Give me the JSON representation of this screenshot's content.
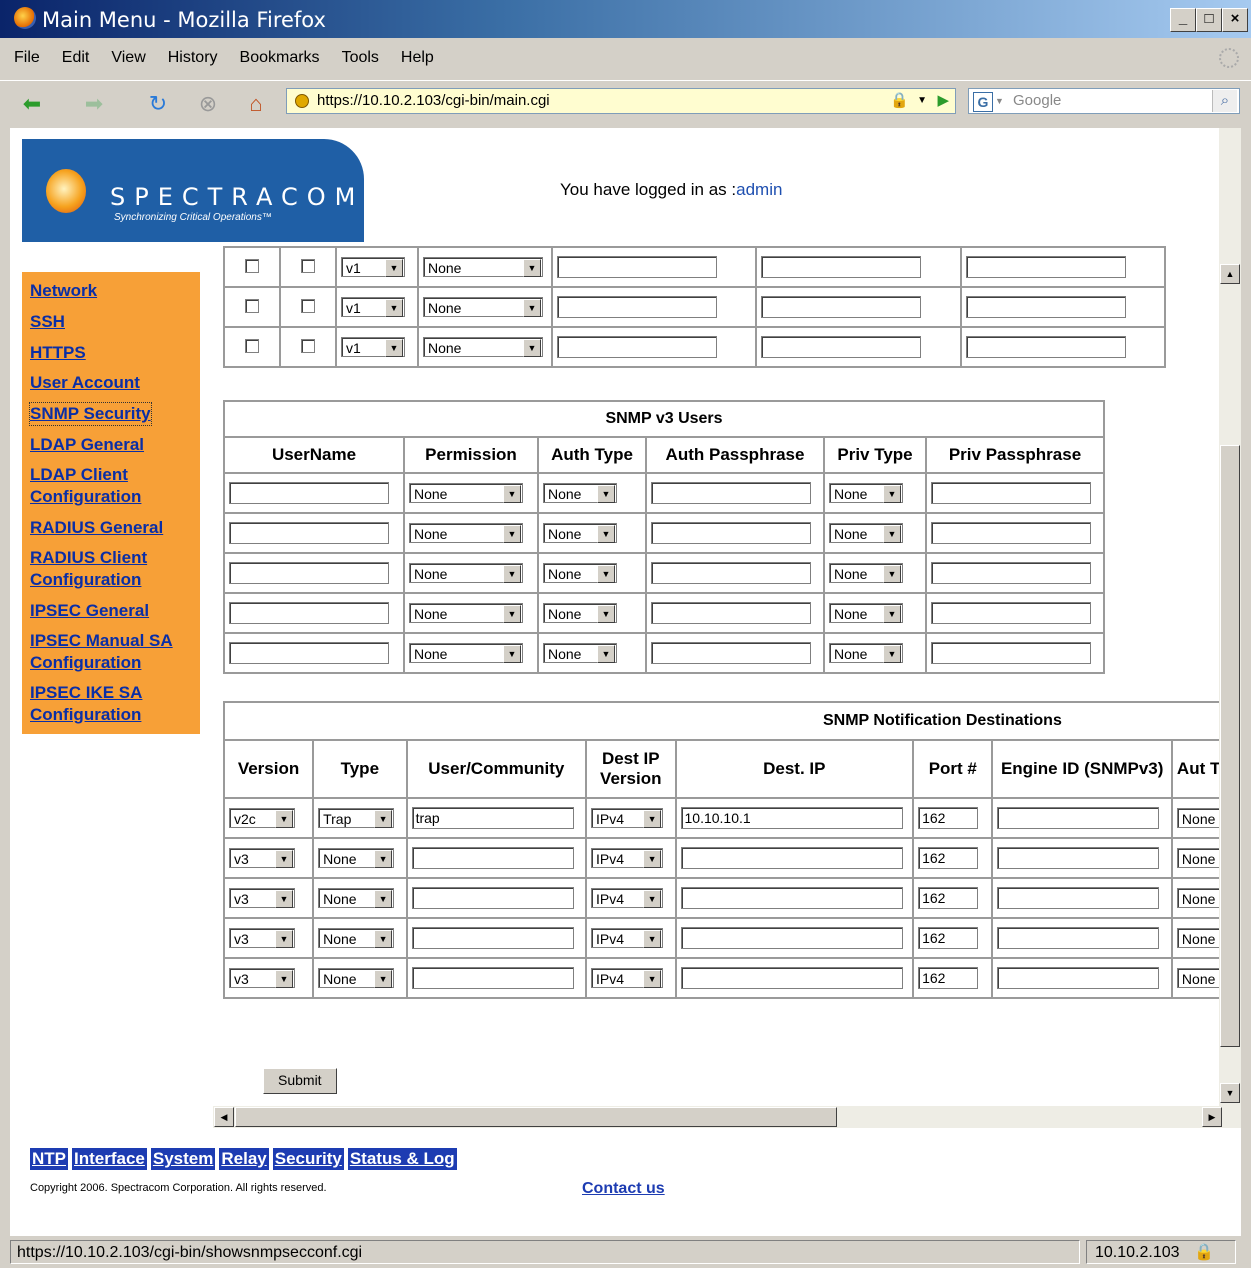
{
  "window": {
    "title": "Main Menu - Mozilla Firefox",
    "min": "_",
    "max": "□",
    "close": "×"
  },
  "menubar": [
    "File",
    "Edit",
    "View",
    "History",
    "Bookmarks",
    "Tools",
    "Help"
  ],
  "navbar": {
    "url": "https://10.10.2.103/cgi-bin/main.cgi",
    "search_placeholder": "Google"
  },
  "logo": {
    "brand": "SPECTRACOM",
    "tagline": "Synchronizing Critical Operations™"
  },
  "login": {
    "prefix": "You have logged in as :",
    "user": "admin"
  },
  "sidebar": [
    "Network",
    "SSH",
    "HTTPS",
    "User Account",
    "SNMP Security",
    "LDAP General",
    "LDAP Client Configuration",
    "RADIUS General",
    "RADIUS Client Configuration",
    "IPSEC General",
    "IPSEC Manual SA Configuration",
    "IPSEC IKE SA Configuration"
  ],
  "community_rows": [
    {
      "version": "v1",
      "permission": "None"
    },
    {
      "version": "v1",
      "permission": "None"
    },
    {
      "version": "v1",
      "permission": "None"
    }
  ],
  "v3users": {
    "caption": "SNMP v3 Users",
    "headers": [
      "UserName",
      "Permission",
      "Auth Type",
      "Auth Passphrase",
      "Priv Type",
      "Priv Passphrase"
    ],
    "rows": [
      {
        "permission": "None",
        "auth_type": "None",
        "priv_type": "None"
      },
      {
        "permission": "None",
        "auth_type": "None",
        "priv_type": "None"
      },
      {
        "permission": "None",
        "auth_type": "None",
        "priv_type": "None"
      },
      {
        "permission": "None",
        "auth_type": "None",
        "priv_type": "None"
      },
      {
        "permission": "None",
        "auth_type": "None",
        "priv_type": "None"
      }
    ]
  },
  "notif": {
    "caption": "SNMP Notification Destinations",
    "headers": [
      "Version",
      "Type",
      "User/Community",
      "Dest IP Version",
      "Dest. IP",
      "Port #",
      "Engine ID (SNMPv3)",
      "Aut Typ"
    ],
    "rows": [
      {
        "version": "v2c",
        "type": "Trap",
        "community": "trap",
        "ipver": "IPv4",
        "ip": "10.10.10.1",
        "port": "162",
        "auth": "None"
      },
      {
        "version": "v3",
        "type": "None",
        "community": "",
        "ipver": "IPv4",
        "ip": "",
        "port": "162",
        "auth": "None"
      },
      {
        "version": "v3",
        "type": "None",
        "community": "",
        "ipver": "IPv4",
        "ip": "",
        "port": "162",
        "auth": "None"
      },
      {
        "version": "v3",
        "type": "None",
        "community": "",
        "ipver": "IPv4",
        "ip": "",
        "port": "162",
        "auth": "None"
      },
      {
        "version": "v3",
        "type": "None",
        "community": "",
        "ipver": "IPv4",
        "ip": "",
        "port": "162",
        "auth": "None"
      }
    ]
  },
  "submit_label": "Submit",
  "footer_links": [
    "NTP",
    "Interface",
    "System",
    "Relay",
    "Security",
    "Status & Log"
  ],
  "copyright": "Copyright 2006. Spectracom Corporation. All rights reserved.",
  "contact": "Contact us",
  "statusbar": {
    "url": "https://10.10.2.103/cgi-bin/showsnmpsecconf.cgi",
    "host": "10.10.2.103"
  }
}
